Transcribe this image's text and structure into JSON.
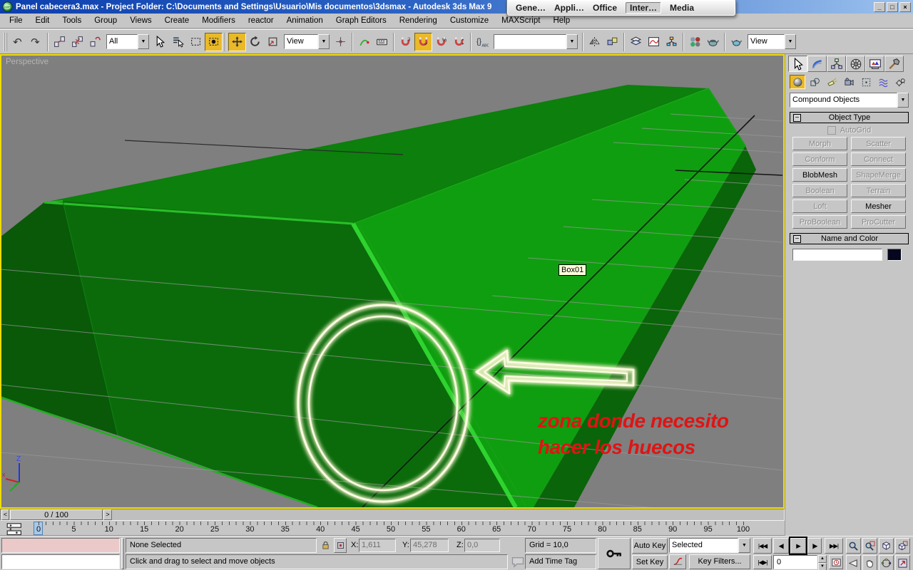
{
  "window": {
    "title": "Panel cabecera3.max     - Project Folder: C:\\Documents and Settings\\Usuario\\Mis documentos\\3dsmax     - Autodesk 3ds Max 9",
    "minimize": "_",
    "restore": "□",
    "close": "×"
  },
  "floating_toolbar": {
    "items": [
      "Gene…",
      "Appli…",
      "Office",
      "Inter…",
      "Media"
    ],
    "active_index": 3
  },
  "menubar": {
    "items": [
      "File",
      "Edit",
      "Tools",
      "Group",
      "Views",
      "Create",
      "Modifiers",
      "reactor",
      "Animation",
      "Graph Editors",
      "Rendering",
      "Customize",
      "MAXScript",
      "Help"
    ]
  },
  "toolbar": {
    "selection_filter": "All",
    "coord_system": "View",
    "named_selection": "",
    "render_type": "View"
  },
  "viewport": {
    "label": "Perspective",
    "object_label": "Box01",
    "annotation": {
      "line1": "zona donde necesito",
      "line2": "hacer los huecos"
    },
    "axis": {
      "x": "x",
      "z": "Z"
    }
  },
  "command_panel": {
    "tabs": [
      "create",
      "modify",
      "hierarchy",
      "motion",
      "display",
      "utilities"
    ],
    "active_tab": "create",
    "categories": [
      "geometry",
      "shapes",
      "lights",
      "cameras",
      "helpers",
      "space-warps",
      "systems"
    ],
    "active_category": "geometry",
    "category_dropdown": "Compound Objects",
    "object_type_rollout": {
      "title": "Object Type",
      "autogrid_label": "AutoGrid",
      "buttons": [
        {
          "label": "Morph",
          "enabled": false
        },
        {
          "label": "Scatter",
          "enabled": false
        },
        {
          "label": "Conform",
          "enabled": false
        },
        {
          "label": "Connect",
          "enabled": false
        },
        {
          "label": "BlobMesh",
          "enabled": true
        },
        {
          "label": "ShapeMerge",
          "enabled": false
        },
        {
          "label": "Boolean",
          "enabled": false
        },
        {
          "label": "Terrain",
          "enabled": false
        },
        {
          "label": "Loft",
          "enabled": false
        },
        {
          "label": "Mesher",
          "enabled": true
        },
        {
          "label": "ProBoolean",
          "enabled": false
        },
        {
          "label": "ProCutter",
          "enabled": false
        }
      ]
    },
    "name_color_rollout": {
      "title": "Name and Color",
      "name_value": ""
    }
  },
  "timeline": {
    "slider_label": "0 / 100",
    "ruler_labels": [
      "0",
      "5",
      "10",
      "15",
      "20",
      "25",
      "30",
      "35",
      "40",
      "45",
      "50",
      "55",
      "60",
      "65",
      "70",
      "75",
      "80",
      "85",
      "90",
      "95",
      "100"
    ],
    "current_frame_index": 0
  },
  "status": {
    "selection_status": "None Selected",
    "prompt": "Click and drag to select and move objects",
    "x_label": "X:",
    "x_value": "1,611",
    "y_label": "Y:",
    "y_value": "45,278",
    "z_label": "Z:",
    "z_value": "0,0",
    "grid_label": "Grid = 10,0",
    "add_time_tag": "Add Time Tag",
    "auto_key": "Auto Key",
    "set_key": "Set Key",
    "key_filter_dropdown": "Selected",
    "key_filters": "Key Filters...",
    "frame_value": "0"
  },
  "colors": {
    "titlebar_left": "#0d3fae",
    "titlebar_right": "#9cc2ee",
    "ui_gray": "#c6c6c6",
    "pressed_yellow": "#eab928",
    "viewport_bg": "#7f7f7f",
    "active_viewport_border": "#efdc00",
    "green_bright": "#0f9e0f",
    "green_top_band": "#0c7f0c",
    "green_front": "#0b6b0b",
    "green_end_cap": "#095909",
    "green_side_strip": "#0a6409",
    "edge_highlight": "#2fd32f",
    "annotation_outline": "#f8f8dc",
    "annotation_text_red": "#df1414",
    "frame_marker_blue": "#a9c8e4"
  }
}
